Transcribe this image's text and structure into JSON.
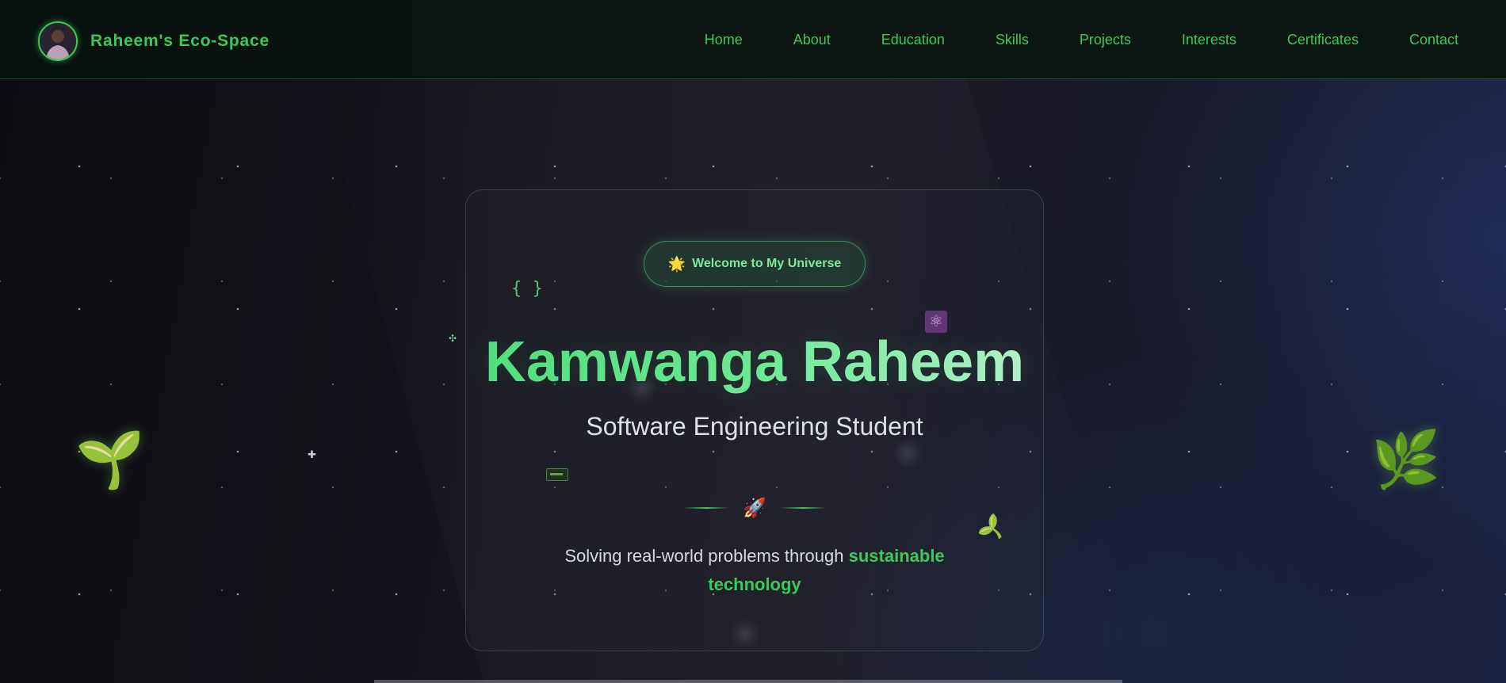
{
  "header": {
    "brand_name": "Raheem's Eco-Space",
    "avatar_alt": "profile-photo",
    "nav": [
      {
        "label": "Home"
      },
      {
        "label": "About"
      },
      {
        "label": "Education"
      },
      {
        "label": "Skills"
      },
      {
        "label": "Projects"
      },
      {
        "label": "Interests"
      },
      {
        "label": "Certificates"
      },
      {
        "label": "Contact"
      }
    ]
  },
  "hero": {
    "badge_icon": "🌟",
    "badge_label": "Welcome to My Universe",
    "name": "Kamwanga Raheem",
    "subtitle": "Software Engineering Student",
    "divider_icon": "🚀",
    "tagline_prefix": "Solving real-world problems through ",
    "tagline_highlight": "sustainable technology"
  },
  "decor": {
    "braces": "{ }",
    "atom_icon": "⚛",
    "sprout_left_icon": "🌱",
    "leaf_right_icon": "🌿",
    "sprout_small_icon": "🌱",
    "spark_icon": "✣",
    "spark_icon_2": "✚"
  },
  "colors": {
    "accent": "#3dc95a",
    "accent_light": "#7ee89a",
    "background": "#0d0c12",
    "header_bg": "#0b1612",
    "text": "#dde1e6"
  }
}
